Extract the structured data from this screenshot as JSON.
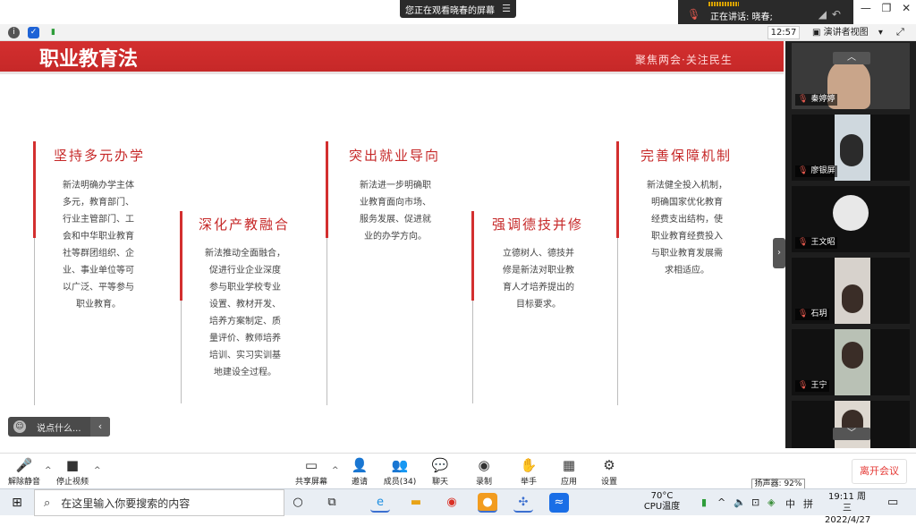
{
  "top": {
    "share_banner": "您正在观看晓春的屏幕",
    "speaking_label": "正在讲话: 晓春;",
    "window_controls": [
      "—",
      "❐",
      "✕"
    ]
  },
  "toolbar": {
    "time": "12:57",
    "view_label": "演讲者视图",
    "view_caret": "▾"
  },
  "slide": {
    "title": "职业教育法",
    "subtitle": "聚焦两会·关注民生",
    "columns": [
      {
        "heading": "坚持多元办学",
        "lines": [
          "新法明确办学主体",
          "多元，教育部门、",
          "行业主管部门、工",
          "会和中华职业教育",
          "社等群团组织、企",
          "业、事业单位等可",
          "以广泛、平等参与",
          "职业教育。"
        ]
      },
      {
        "heading": "深化产教融合",
        "lines": [
          "新法推动全面融合，",
          "促进行业企业深度",
          "参与职业学校专业",
          "设置、教材开发、",
          "培养方案制定、质",
          "量评价、教师培养",
          "培训、实习实训基",
          "地建设全过程。"
        ]
      },
      {
        "heading": "突出就业导向",
        "lines": [
          "新法进一步明确职",
          "业教育面向市场、",
          "服务发展、促进就",
          "业的办学方向。"
        ]
      },
      {
        "heading": "强调德技并修",
        "lines": [
          "立德树人、德技并",
          "修是新法对职业教",
          "育人才培养提出的",
          "目标要求。"
        ]
      },
      {
        "heading": "完善保障机制",
        "lines": [
          "新法健全投入机制，",
          "明确国家优化教育",
          "经费支出结构，使",
          "职业教育经费投入",
          "与职业教育发展需",
          "求相适应。"
        ]
      }
    ]
  },
  "chat_hint": {
    "placeholder": "说点什么...",
    "arrow": "‹"
  },
  "gallery": {
    "participants": [
      {
        "name": "秦婷婷"
      },
      {
        "name": "廖银屏"
      },
      {
        "name": "王文昭"
      },
      {
        "name": "石玥"
      },
      {
        "name": "王宁"
      },
      {
        "name": ""
      }
    ],
    "up": "︿",
    "down": "﹀"
  },
  "controls": {
    "items": [
      {
        "label": "解除静音",
        "icon": "🎤"
      },
      {
        "label": "停止视频",
        "icon": "■"
      },
      {
        "label": "共享屏幕",
        "icon": "▭"
      },
      {
        "label": "邀请",
        "icon": "👤"
      },
      {
        "label": "成员(34)",
        "icon": "👥"
      },
      {
        "label": "聊天",
        "icon": "💬"
      },
      {
        "label": "录制",
        "icon": "◉"
      },
      {
        "label": "举手",
        "icon": "✋"
      },
      {
        "label": "应用",
        "icon": "▦"
      },
      {
        "label": "设置",
        "icon": "⚙"
      }
    ],
    "leave": "离开会议",
    "speaker_tip": "扬声器: 92%"
  },
  "taskbar": {
    "search_placeholder": "在这里输入你要搜索的内容",
    "weather_temp": "70°C",
    "weather_label": "CPU温度",
    "ime": "中",
    "time": "19:11 周三",
    "date": "2022/4/27"
  },
  "colors": {
    "slide_red": "#c62828",
    "leave_red": "#e53935",
    "gallery_bg": "#1e1e1e"
  }
}
